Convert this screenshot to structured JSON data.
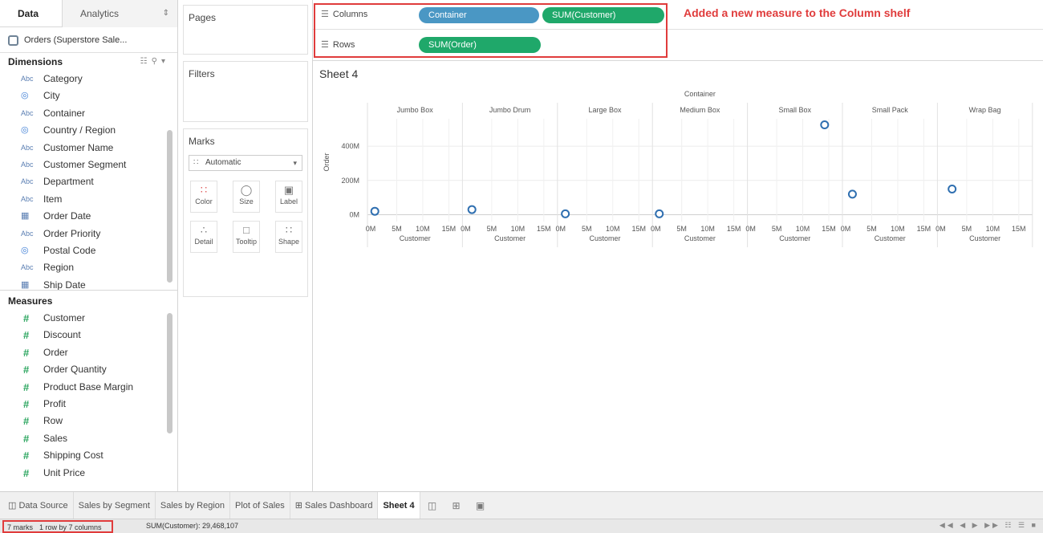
{
  "left_pane": {
    "tabs": {
      "data": "Data",
      "analytics": "Analytics"
    },
    "datasource": "Orders (Superstore Sale...",
    "dimensions_header": "Dimensions",
    "dimensions": [
      {
        "label": "Category",
        "type": "Abc"
      },
      {
        "label": "City",
        "type": "globe"
      },
      {
        "label": "Container",
        "type": "Abc"
      },
      {
        "label": "Country / Region",
        "type": "globe"
      },
      {
        "label": "Customer Name",
        "type": "Abc"
      },
      {
        "label": "Customer Segment",
        "type": "Abc"
      },
      {
        "label": "Department",
        "type": "Abc"
      },
      {
        "label": "Item",
        "type": "Abc"
      },
      {
        "label": "Order Date",
        "type": "date"
      },
      {
        "label": "Order Priority",
        "type": "Abc"
      },
      {
        "label": "Postal Code",
        "type": "globe"
      },
      {
        "label": "Region",
        "type": "Abc"
      },
      {
        "label": "Ship Date",
        "type": "date"
      }
    ],
    "measures_header": "Measures",
    "measures": [
      "Customer",
      "Discount",
      "Order",
      "Order Quantity",
      "Product Base Margin",
      "Profit",
      "Row",
      "Sales",
      "Shipping Cost",
      "Unit Price"
    ]
  },
  "cards": {
    "pages": "Pages",
    "filters": "Filters",
    "marks": "Marks",
    "mark_type": "Automatic",
    "mark_buttons": [
      "Color",
      "Size",
      "Label",
      "Detail",
      "Tooltip",
      "Shape"
    ]
  },
  "shelves": {
    "columns_label": "Columns",
    "rows_label": "Rows",
    "columns_pills": [
      "Container",
      "SUM(Customer)"
    ],
    "rows_pills": [
      "SUM(Order)"
    ],
    "annotation": "Added a new measure to the Column shelf"
  },
  "sheet": {
    "title": "Sheet 4"
  },
  "chart_data": {
    "type": "scatter",
    "header_title": "Container",
    "panes": [
      "Jumbo Box",
      "Jumbo Drum",
      "Large Box",
      "Medium Box",
      "Small Box",
      "Small Pack",
      "Wrap Bag"
    ],
    "x_ticks": [
      "0M",
      "5M",
      "10M",
      "15M"
    ],
    "x_tick_values": [
      0,
      5,
      10,
      15
    ],
    "xlim": [
      0,
      17
    ],
    "xlabel": "Customer",
    "ylabel": "Order",
    "y_ticks": [
      "0M",
      "200M",
      "400M"
    ],
    "y_tick_values": [
      0,
      200,
      400
    ],
    "ylim": [
      -40,
      560
    ],
    "points": [
      {
        "pane": "Jumbo Box",
        "x": 0.8,
        "y": 20
      },
      {
        "pane": "Jumbo Drum",
        "x": 1.2,
        "y": 30
      },
      {
        "pane": "Large Box",
        "x": 0.9,
        "y": 5
      },
      {
        "pane": "Medium Box",
        "x": 0.7,
        "y": 5
      },
      {
        "pane": "Small Box",
        "x": 14.2,
        "y": 525
      },
      {
        "pane": "Small Pack",
        "x": 1.3,
        "y": 120
      },
      {
        "pane": "Wrap Bag",
        "x": 2.2,
        "y": 150
      }
    ],
    "grid": true,
    "marker_color": "#2f6fb0"
  },
  "tabbar": {
    "tabs": [
      "Data Source",
      "Sales by Segment",
      "Sales by Region",
      "Plot of Sales",
      "Sales Dashboard",
      "Sheet 4"
    ],
    "active": "Sheet 4"
  },
  "status": {
    "marks": "7 marks",
    "dims": "1 row by 7 columns",
    "sum": "SUM(Customer): 29,468,107"
  }
}
